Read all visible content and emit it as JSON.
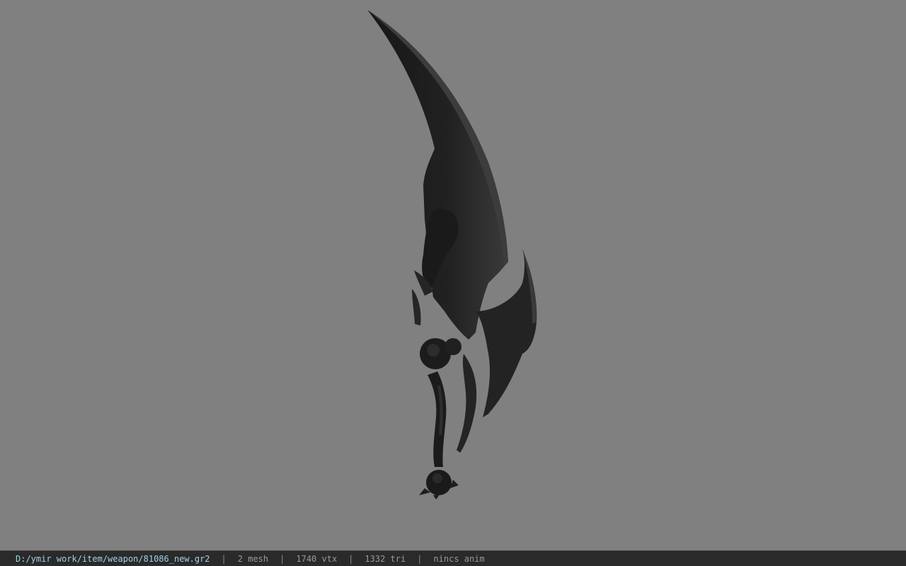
{
  "viewport": {
    "background_color": "#808080",
    "model_color": "#1e1e1e"
  },
  "statusbar": {
    "file_path": "D:/ymir work/item/weapon/81086_new.gr2",
    "separator": "|",
    "mesh_count": "2 mesh",
    "vertex_count": "1740 vtx",
    "triangle_count": "1332 tri",
    "anim_status": "nincs anim",
    "path_color": "#9fd3e6",
    "background_color": "#2a2a2a"
  }
}
